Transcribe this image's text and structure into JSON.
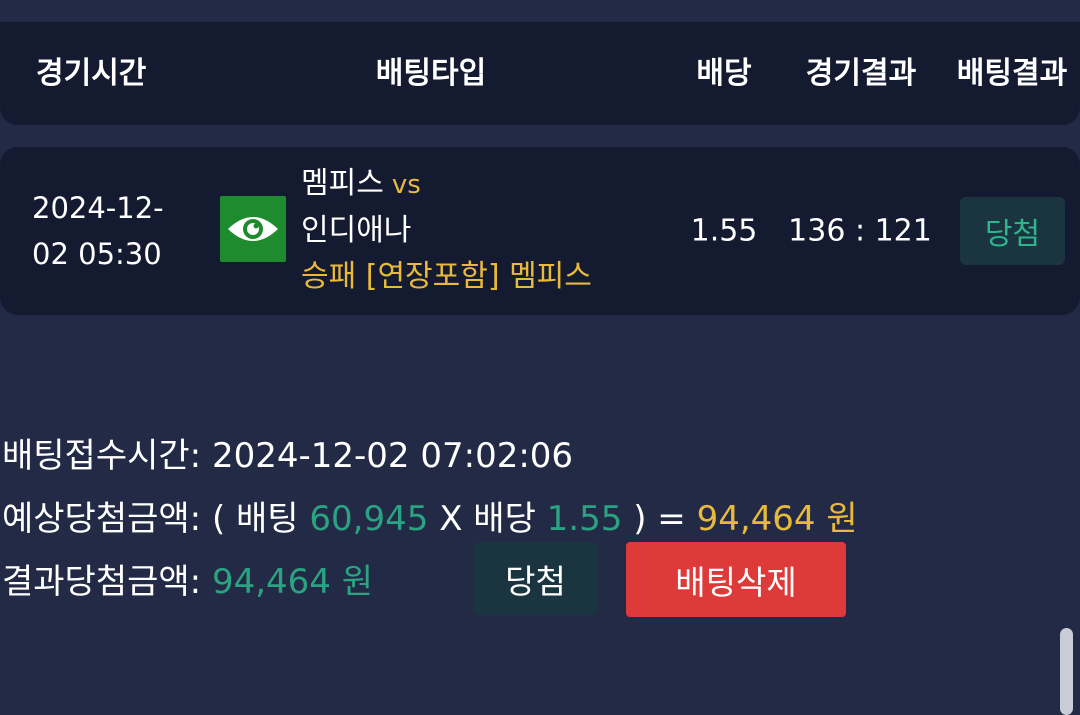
{
  "header": {
    "col_time": "경기시간",
    "col_bet_type": "배팅타입",
    "col_odds": "배당",
    "col_game_result": "경기결과",
    "col_bet_result": "배팅결과"
  },
  "row": {
    "date_line1": "2024-12-",
    "date_line2": "02 05:30",
    "icon": "eye-icon",
    "home_team": "멤피스",
    "vs": "vs",
    "away_team": "인디애나",
    "pick": "승패 [연장포함] 멤피스",
    "odds": "1.55",
    "score": "136 : 121",
    "status": "당첨"
  },
  "details": {
    "received_label": "배팅접수시간:",
    "received_value": "2024-12-02 07:02:06",
    "expected_label": "예상당첨금액:",
    "expected_open": "( 배팅",
    "expected_stake": "60,945",
    "expected_x": "X 배당",
    "expected_odds": "1.55",
    "expected_eq": ") =",
    "expected_amount": "94,464 원",
    "result_label": "결과당첨금액:",
    "result_amount": "94,464 원",
    "result_status": "당첨",
    "delete_button": "배팅삭제"
  },
  "colors": {
    "background": "#232a45",
    "card": "#141a30",
    "gold": "#e8b93a",
    "green": "#2aa383",
    "win_badge_bg": "#1a3440",
    "delete_red": "#de3a3a",
    "eye_green": "#1e8c2e"
  }
}
